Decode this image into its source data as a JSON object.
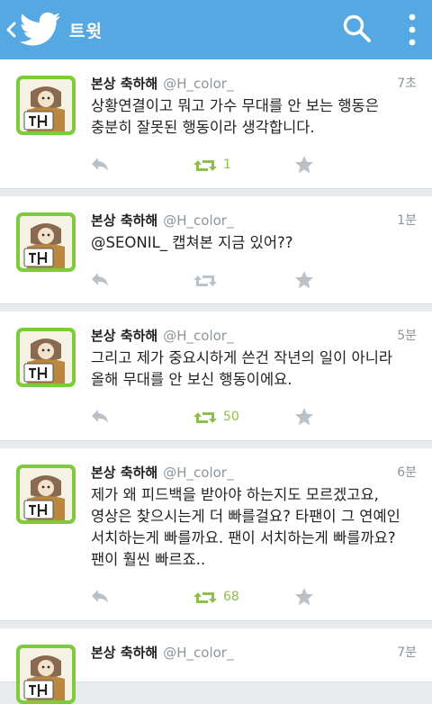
{
  "header": {
    "title": "트윗",
    "bar_color": "#56a8e3",
    "icons": [
      "back-chevron-icon",
      "twitter-bird-icon",
      "search-icon",
      "more-vertical-icon"
    ]
  },
  "tweets": [
    {
      "name": "본상 축하해",
      "handle": "@H_color_",
      "time": "7초",
      "lines": [
        "상황연결이고 뭐고 가수 무대를 안 보는 행동은",
        "충분히 잘못된 행동이라 생각합니다."
      ],
      "retweets": "1",
      "retweeted": true
    },
    {
      "name": "본상 축하해",
      "handle": "@H_color_",
      "time": "1분",
      "lines": [
        "@SEONIL_ 캡쳐본 지금 있어??"
      ],
      "retweets": "",
      "retweeted": false
    },
    {
      "name": "본상 축하해",
      "handle": "@H_color_",
      "time": "5분",
      "lines": [
        "그리고 제가 중요시하게 쓴건 작년의 일이 아니라",
        "올해 무대를 안 보신 행동이에요."
      ],
      "retweets": "50",
      "retweeted": true
    },
    {
      "name": "본상 축하해",
      "handle": "@H_color_",
      "time": "6분",
      "lines": [
        "제가 왜 피드백을 받아야 하는지도 모르겠고요,",
        "영상은 찾으시는게 더 빠를걸요? 타팬이 그 연예인",
        "서치하는게 빠를까요. 팬이 서치하는게 빠를까요?",
        "팬이 훨씬 빠르죠.."
      ],
      "retweets": "68",
      "retweeted": true
    },
    {
      "name": "본상 축하해",
      "handle": "@H_color_",
      "time": "7분",
      "lines": [],
      "retweets": "",
      "retweeted": false
    }
  ],
  "colors": {
    "retweet_active": "#8fbf4b",
    "icon_inactive": "#b9c2c9",
    "avatar_border": "#7ecb3b"
  }
}
